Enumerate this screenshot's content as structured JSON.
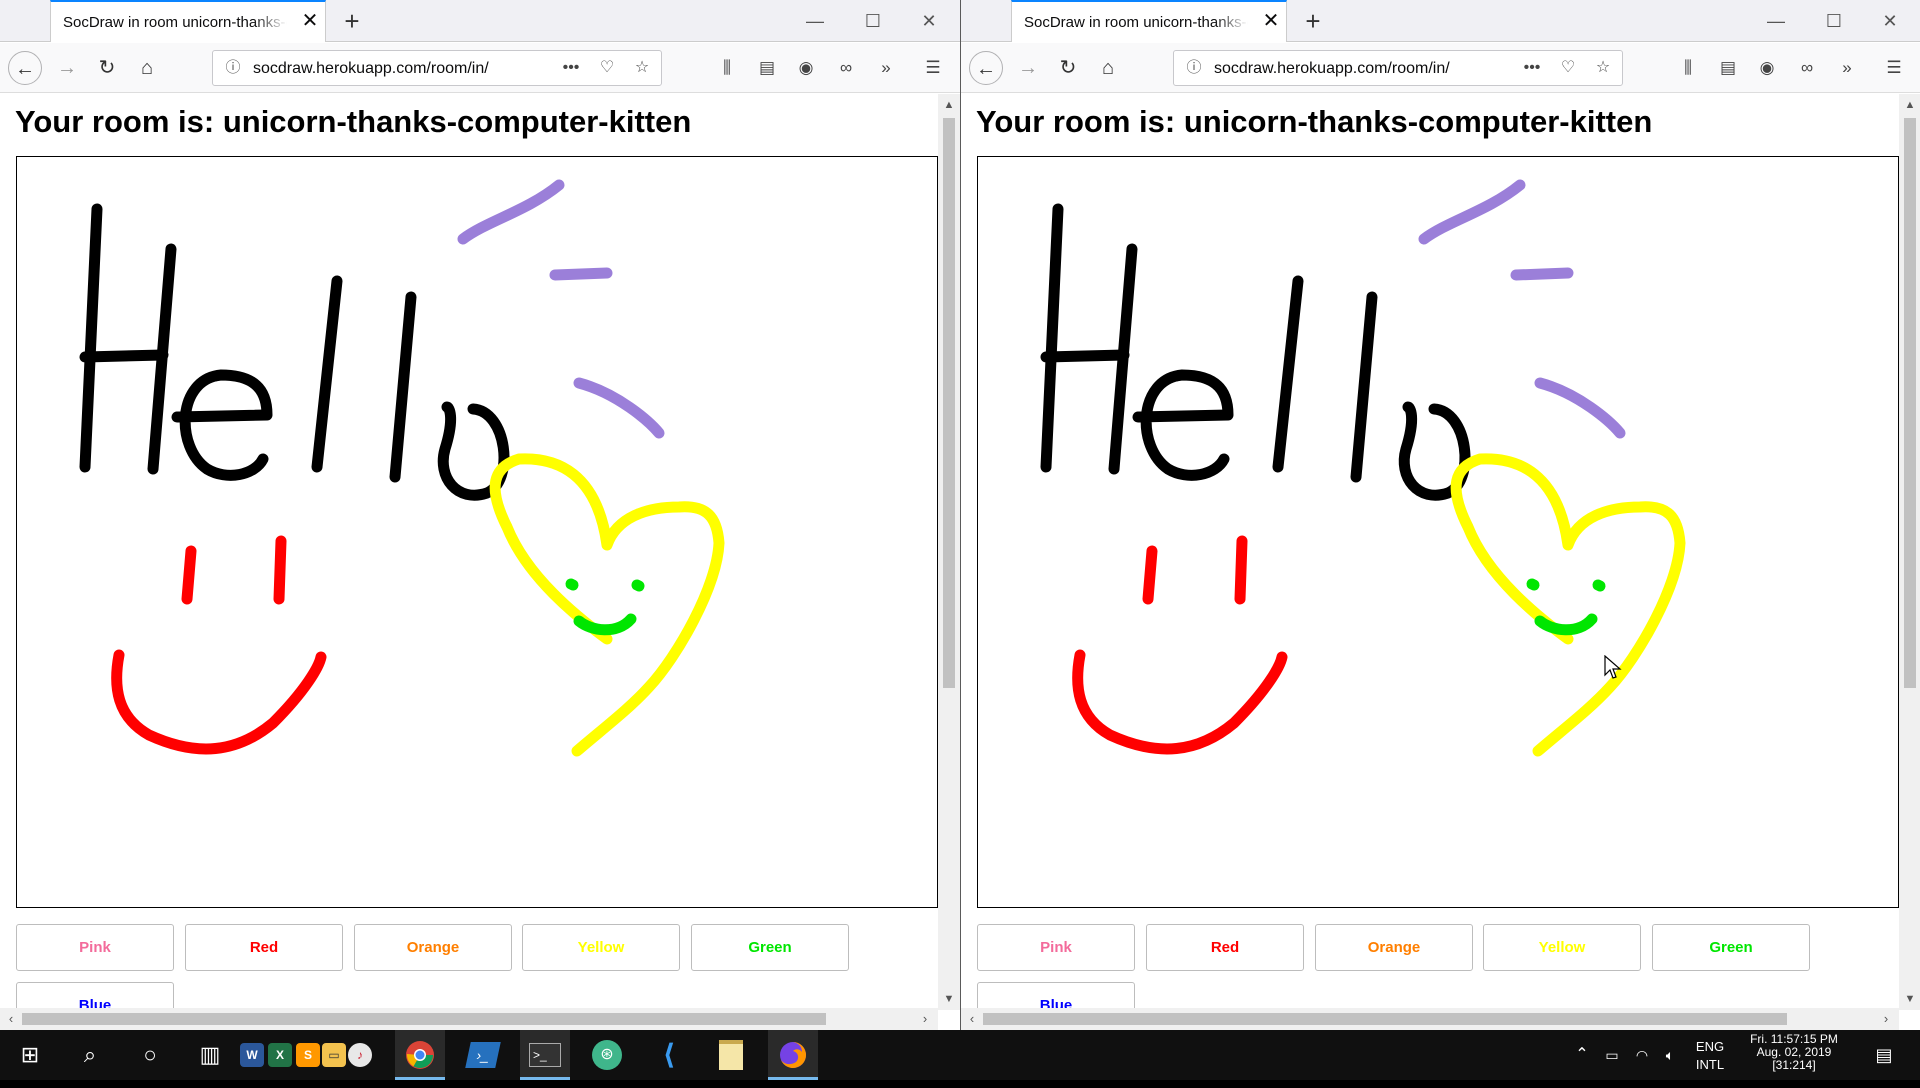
{
  "browser": {
    "tab_title": "SocDraw in room unicorn-thanks-computer-kitten",
    "url": "socdraw.herokuapp.com/room/in/",
    "icons": {
      "close_tab": "close-icon",
      "new_tab": "plus-icon",
      "back": "arrow-left-icon",
      "forward": "arrow-right-icon",
      "reload": "reload-icon",
      "home": "home-icon",
      "page_actions": "ellipsis-icon",
      "pocket": "pocket-icon",
      "bookmark": "star-icon",
      "library": "library-icon",
      "sidebar": "sidebar-icon",
      "account": "account-icon",
      "link": "link-icon",
      "overflow": "chevrons-icon",
      "menu": "hamburger-icon"
    }
  },
  "page": {
    "title": "Your room is: unicorn-thanks-computer-kitten",
    "color_buttons": [
      {
        "label": "Pink",
        "color": "#f36b9b"
      },
      {
        "label": "Red",
        "color": "#ff0000"
      },
      {
        "label": "Orange",
        "color": "#ff7f00"
      },
      {
        "label": "Yellow",
        "color": "#ffff00"
      },
      {
        "label": "Green",
        "color": "#00e600"
      },
      {
        "label": "Blue",
        "color": "#0000ff"
      }
    ],
    "stroke_colors": {
      "black": "#000000",
      "purple": "#9b7fd9",
      "red": "#ff0000",
      "yellow": "#ffff00",
      "green": "#00e600"
    }
  },
  "taskbar": {
    "apps": [
      "windows-start-icon",
      "search-icon",
      "cortana-icon",
      "task-view-icon",
      "word-icon",
      "excel-icon",
      "sublime-icon",
      "file-explorer-icon",
      "itunes-icon",
      "chrome-icon",
      "powershell-icon",
      "terminal-icon",
      "browser-app-icon",
      "vscode-icon",
      "notepad-icon",
      "firefox-icon"
    ],
    "language": "ENG",
    "layout": "INTL",
    "date_line1": "Fri. 11:57:15 PM",
    "date_line2": "Aug. 02, 2019",
    "date_line3": "[31:214]"
  }
}
